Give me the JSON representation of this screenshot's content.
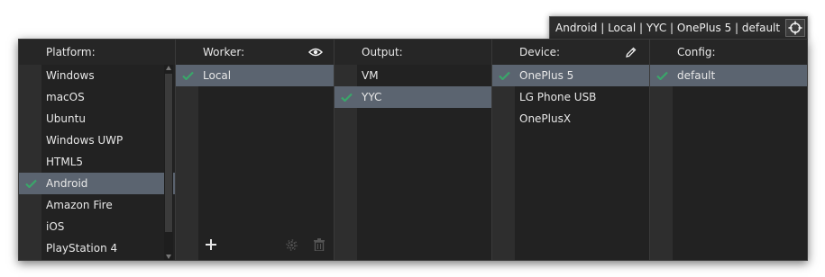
{
  "target_summary": "Android  |  Local  |  YYC  |  OnePlus 5  |  default",
  "columns": {
    "platform": {
      "header": "Platform:",
      "items": [
        "Windows",
        "macOS",
        "Ubuntu",
        "Windows UWP",
        "HTML5",
        "Android",
        "Amazon Fire",
        "iOS",
        "PlayStation 4"
      ],
      "selected": "Android"
    },
    "worker": {
      "header": "Worker:",
      "items": [
        "Local"
      ],
      "selected": "Local"
    },
    "output": {
      "header": "Output:",
      "items": [
        "VM",
        "YYC"
      ],
      "selected": "YYC"
    },
    "device": {
      "header": "Device:",
      "items": [
        "OnePlus 5",
        "LG Phone USB",
        "OnePlusX"
      ],
      "selected": "OnePlus 5"
    },
    "config": {
      "header": "Config:",
      "items": [
        "default"
      ],
      "selected": "default"
    }
  },
  "colors": {
    "panel_bg": "#222222",
    "gutter_bg": "#2e2e2e",
    "selected_bg": "#5b6470",
    "check_color": "#3aa66a",
    "text": "#e8e8e8"
  },
  "icons": {
    "target": "crosshair-icon",
    "worker_header": "eye-icon",
    "device_header": "pencil-icon",
    "add": "plus-icon",
    "settings": "gear-icon",
    "delete": "trash-icon",
    "selection": "check-icon"
  }
}
